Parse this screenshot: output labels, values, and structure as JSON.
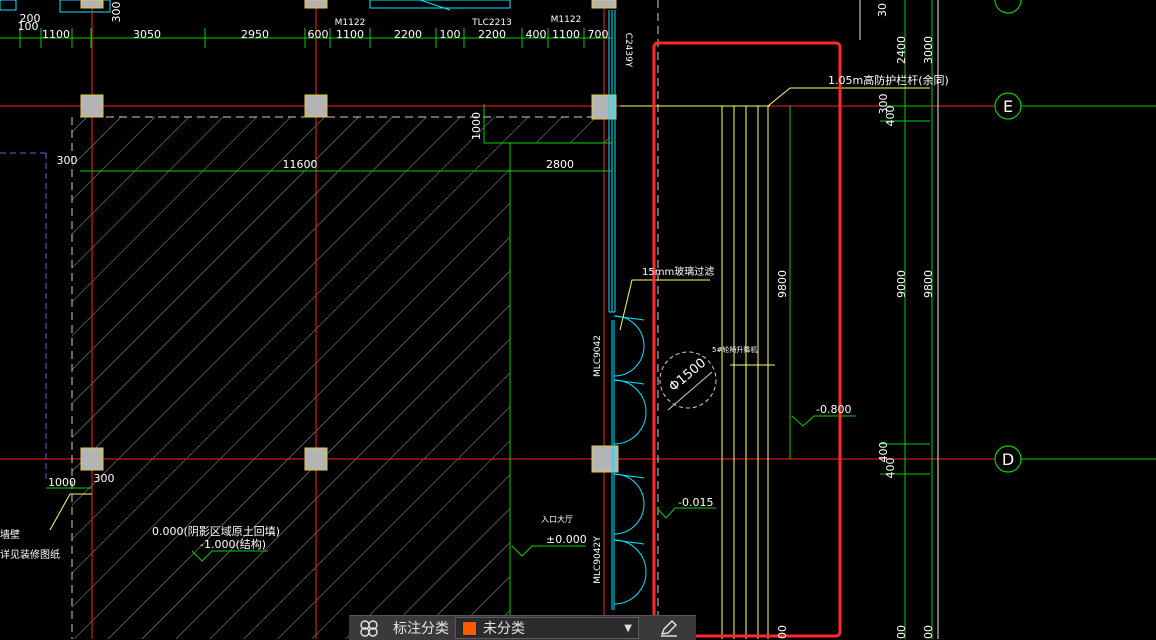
{
  "dimensions_top": [
    "200",
    "100",
    "1100",
    "3050",
    "2950",
    "600",
    "1100",
    "2200",
    "100",
    "2200",
    "400",
    "1100",
    "700",
    "300"
  ],
  "labels_top": {
    "door_a": "M1122",
    "window_a": "TLC2213",
    "door_b": "M1122"
  },
  "window_tag_upper": "C2439Y",
  "railing_note": "1.05m高防护栏杆(余同)",
  "glass_note": "15mm玻璃过滤",
  "lift_label": "5#轮椅升降机",
  "span_labels": {
    "left": "11600",
    "right": "2800"
  },
  "dim_1000": "1000",
  "dim_300_left": "300",
  "dim_300_right": "300",
  "dim_400_top": "400",
  "dim_9800_mid": "9800",
  "right_dims": [
    "2400",
    "3000",
    "9000",
    "9800"
  ],
  "dim_400_lower_a": "400",
  "dim_400_lower_b": "400",
  "dim_bottom_1000": "1000",
  "dim_bottom_300": "300",
  "circle_label": "Φ1500",
  "level_right": "-0.800",
  "level_door": "-0.015",
  "entrance_label": "入口大厅",
  "level_entrance": "±0.000",
  "infill_note": "0.000(阴影区域原土回填)",
  "structure_note": "-1.000(结构)",
  "left_notes": [
    "墙壁",
    "详见装修图纸"
  ],
  "door_tag_mid": "MLC9042",
  "door_tag_lower": "MLC9042Y",
  "grid_axes": [
    "E",
    "D"
  ],
  "dim_bottom_right": [
    "00",
    "00",
    "00"
  ],
  "colors": {
    "grid": "#ff2020",
    "dimension": "#00e000",
    "highlight": "#ff2a2a",
    "column": "#b4b4b4",
    "railing": "#ffff66",
    "window": "#00e5ff",
    "text": "#ffffff"
  },
  "toolbar": {
    "label": "标注分类",
    "selected": "未分类",
    "swatch_color": "#ff5a00",
    "left_icon": "layers-icon",
    "right_icon": "edit-icon"
  }
}
